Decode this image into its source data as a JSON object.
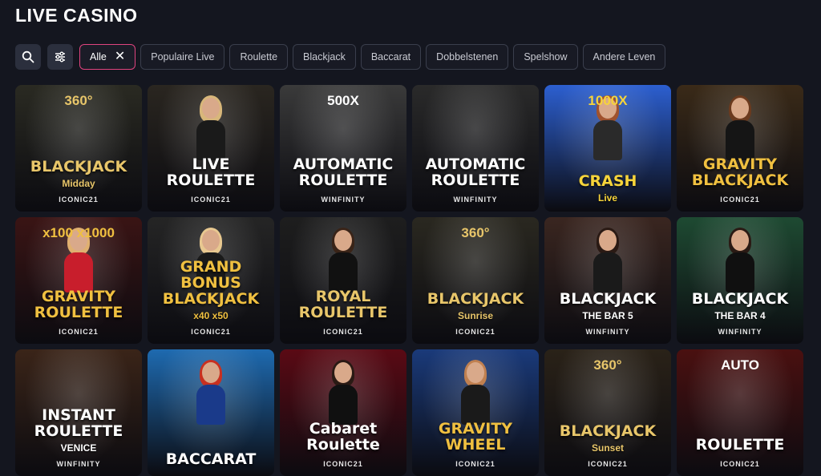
{
  "page": {
    "title": "LIVE CASINO"
  },
  "filters": {
    "search_icon": "search-icon",
    "settings_icon": "sliders-icon",
    "active_chip": {
      "label": "Alle",
      "close": "✕"
    },
    "chips": [
      "Populaire Live",
      "Roulette",
      "Blackjack",
      "Baccarat",
      "Dobbelstenen",
      "Spelshow",
      "Andere Leven"
    ]
  },
  "games": [
    {
      "top": "360°",
      "main": "BLACKJACK",
      "sub": "Midday",
      "logo": "ICONIC21",
      "bg": "#2a2a22",
      "accent": "#e8c66a",
      "figure": false
    },
    {
      "top": "",
      "main": "LIVE ROULETTE",
      "sub": "",
      "logo": "ICONIC21",
      "bg": "#2a2620",
      "accent": "#ffffff",
      "figure": true,
      "hair": "#d8b77a",
      "dress": "#1a1a1a"
    },
    {
      "top": "500X",
      "main": "AUTOMATIC ROULETTE",
      "sub": "",
      "logo": "WINFINITY",
      "bg": "#3a3a3a",
      "accent": "#ffffff",
      "figure": false
    },
    {
      "top": "",
      "main": "AUTOMATIC ROULETTE",
      "sub": "",
      "logo": "WINFINITY",
      "bg": "#2a2a2a",
      "accent": "#ffffff",
      "figure": false
    },
    {
      "top": "1000X",
      "main": "CRASH",
      "sub": "Live",
      "logo": "",
      "bg": "#2c5fd0",
      "accent": "#f7d43a",
      "figure": true,
      "hair": "#a0522d",
      "dress": "#2a2a2a"
    },
    {
      "top": "",
      "main": "GRAVITY BLACKJACK",
      "sub": "",
      "logo": "ICONIC21",
      "bg": "#3a2a18",
      "accent": "#f0c040",
      "figure": true,
      "hair": "#6b3a1e",
      "dress": "#151515"
    },
    {
      "top": "x100 x1000",
      "main": "GRAVITY ROULETTE",
      "sub": "",
      "logo": "ICONIC21",
      "bg": "#3a1414",
      "accent": "#f0c040",
      "figure": true,
      "hair": "#e0b070",
      "dress": "#c81e2c"
    },
    {
      "top": "",
      "main": "GRAND BONUS BLACKJACK",
      "sub": "x40 x50",
      "logo": "ICONIC21",
      "bg": "#252525",
      "accent": "#f0c040",
      "figure": true,
      "hair": "#e8c890",
      "dress": "#1a1a1a"
    },
    {
      "top": "",
      "main": "ROYAL ROULETTE",
      "sub": "",
      "logo": "ICONIC21",
      "bg": "#1e1e1e",
      "accent": "#e8c66a",
      "figure": true,
      "hair": "#3a2418",
      "dress": "#111111"
    },
    {
      "top": "360°",
      "main": "BLACKJACK",
      "sub": "Sunrise",
      "logo": "ICONIC21",
      "bg": "#2a2820",
      "accent": "#e8c66a",
      "figure": false
    },
    {
      "top": "",
      "main": "BLACKJACK",
      "sub": "THE BAR 5",
      "logo": "WINFINITY",
      "bg": "#3a2620",
      "accent": "#ffffff",
      "figure": true,
      "hair": "#2a1a14",
      "dress": "#1a1a1a"
    },
    {
      "top": "",
      "main": "BLACKJACK",
      "sub": "THE BAR 4",
      "logo": "WINFINITY",
      "bg": "#1e4a32",
      "accent": "#ffffff",
      "figure": true,
      "hair": "#2a1a14",
      "dress": "#101010"
    },
    {
      "top": "",
      "main": "INSTANT ROULETTE",
      "sub": "VENICE",
      "logo": "WINFINITY",
      "bg": "#3a2418",
      "accent": "#ffffff",
      "figure": false
    },
    {
      "top": "",
      "main": "BACCARAT",
      "sub": "",
      "logo": "",
      "bg": "#1e6ab0",
      "accent": "#ffffff",
      "figure": true,
      "hair": "#c83020",
      "dress": "#1a3a8a"
    },
    {
      "top": "",
      "main": "Cabaret Roulette",
      "sub": "",
      "logo": "ICONIC21",
      "bg": "#5a0a14",
      "accent": "#ffffff",
      "figure": true,
      "hair": "#2a1a14",
      "dress": "#101010"
    },
    {
      "top": "",
      "main": "GRAVITY WHEEL",
      "sub": "",
      "logo": "ICONIC21",
      "bg": "#1a3a7a",
      "accent": "#f0c040",
      "figure": true,
      "hair": "#c08050",
      "dress": "#1a1a1a"
    },
    {
      "top": "360°",
      "main": "BLACKJACK",
      "sub": "Sunset",
      "logo": "ICONIC21",
      "bg": "#2a2218",
      "accent": "#e8c66a",
      "figure": false
    },
    {
      "top": "AUTO",
      "main": "ROULETTE",
      "sub": "",
      "logo": "ICONIC21",
      "bg": "#4a1010",
      "accent": "#ffffff",
      "figure": false
    }
  ]
}
